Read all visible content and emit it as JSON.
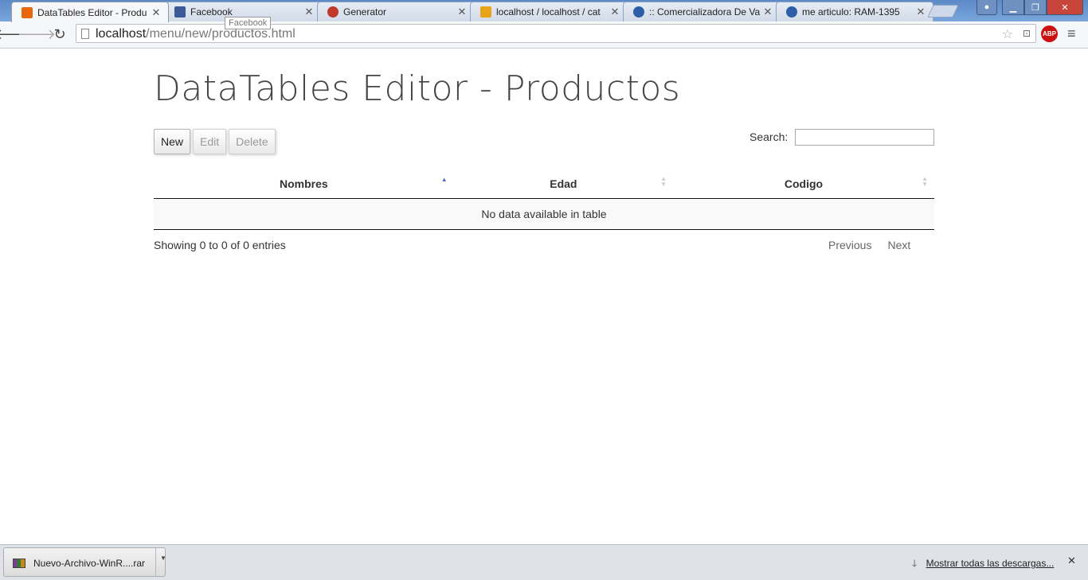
{
  "browser": {
    "tabs": [
      {
        "title": "DataTables Editor - Produ",
        "favicon": "html-orange-icon",
        "color": "#e8660c",
        "active": true
      },
      {
        "title": "Facebook",
        "favicon": "facebook-icon",
        "color": "#3b5998",
        "active": false
      },
      {
        "title": "Generator",
        "favicon": "generator-icon",
        "color": "#c0392b",
        "active": false
      },
      {
        "title": "localhost / localhost / cat",
        "favicon": "phpmyadmin-icon",
        "color": "#e8a317",
        "active": false
      },
      {
        "title": ":: Comercializadora De Va",
        "favicon": "site-icon",
        "color": "#2d5fa8",
        "active": false
      },
      {
        "title": "me articulo: RAM-1395",
        "favicon": "site-icon",
        "color": "#2d5fa8",
        "active": false
      }
    ],
    "tooltip": "Facebook",
    "url_host": "localhost",
    "url_path": "/menu/new/productos.html",
    "abp_label": "ABP"
  },
  "page": {
    "title": "DataTables Editor - Productos",
    "buttons": {
      "new": "New",
      "edit": "Edit",
      "delete": "Delete"
    },
    "search_label": "Search:",
    "search_value": "",
    "table": {
      "columns": [
        "Nombres",
        "Edad",
        "Codigo"
      ],
      "empty_message": "No data available in table"
    },
    "info": "Showing 0 to 0 of 0 entries",
    "paging": {
      "previous": "Previous",
      "next": "Next"
    }
  },
  "downloads": {
    "file_name": "Nuevo-Archivo-WinR....rar",
    "show_all": "Mostrar todas las descargas..."
  }
}
